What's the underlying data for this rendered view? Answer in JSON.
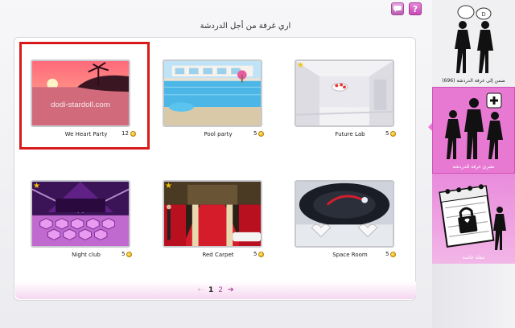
{
  "header": {
    "title": "اري غرفة من أجل الدردشة",
    "chat_icon": "chat-icon",
    "help_icon": "help-icon",
    "help_glyph": "?"
  },
  "rooms": [
    {
      "name": "We Heart Party",
      "count": "12",
      "selected": true,
      "watermark": "dodi-stardoll.com"
    },
    {
      "name": "Pool party",
      "count": "5"
    },
    {
      "name": "Future Lab",
      "count": "5"
    },
    {
      "name": "Night club",
      "count": "5"
    },
    {
      "name": "Red Carpet",
      "count": "5"
    },
    {
      "name": "Space Room",
      "count": "5"
    }
  ],
  "pager": {
    "prev": "⇠",
    "current": "1",
    "next_page": "2",
    "next": "➔"
  },
  "sidebar": {
    "join_label": "ضمن إلى غرفة الدردشة (696)",
    "create_label": "نشري غرفة للدردشة",
    "private_label": "مقلة خاصة"
  },
  "colors": {
    "accent": "#e879d2",
    "selection": "#d81a1a",
    "link": "#b0359a"
  }
}
